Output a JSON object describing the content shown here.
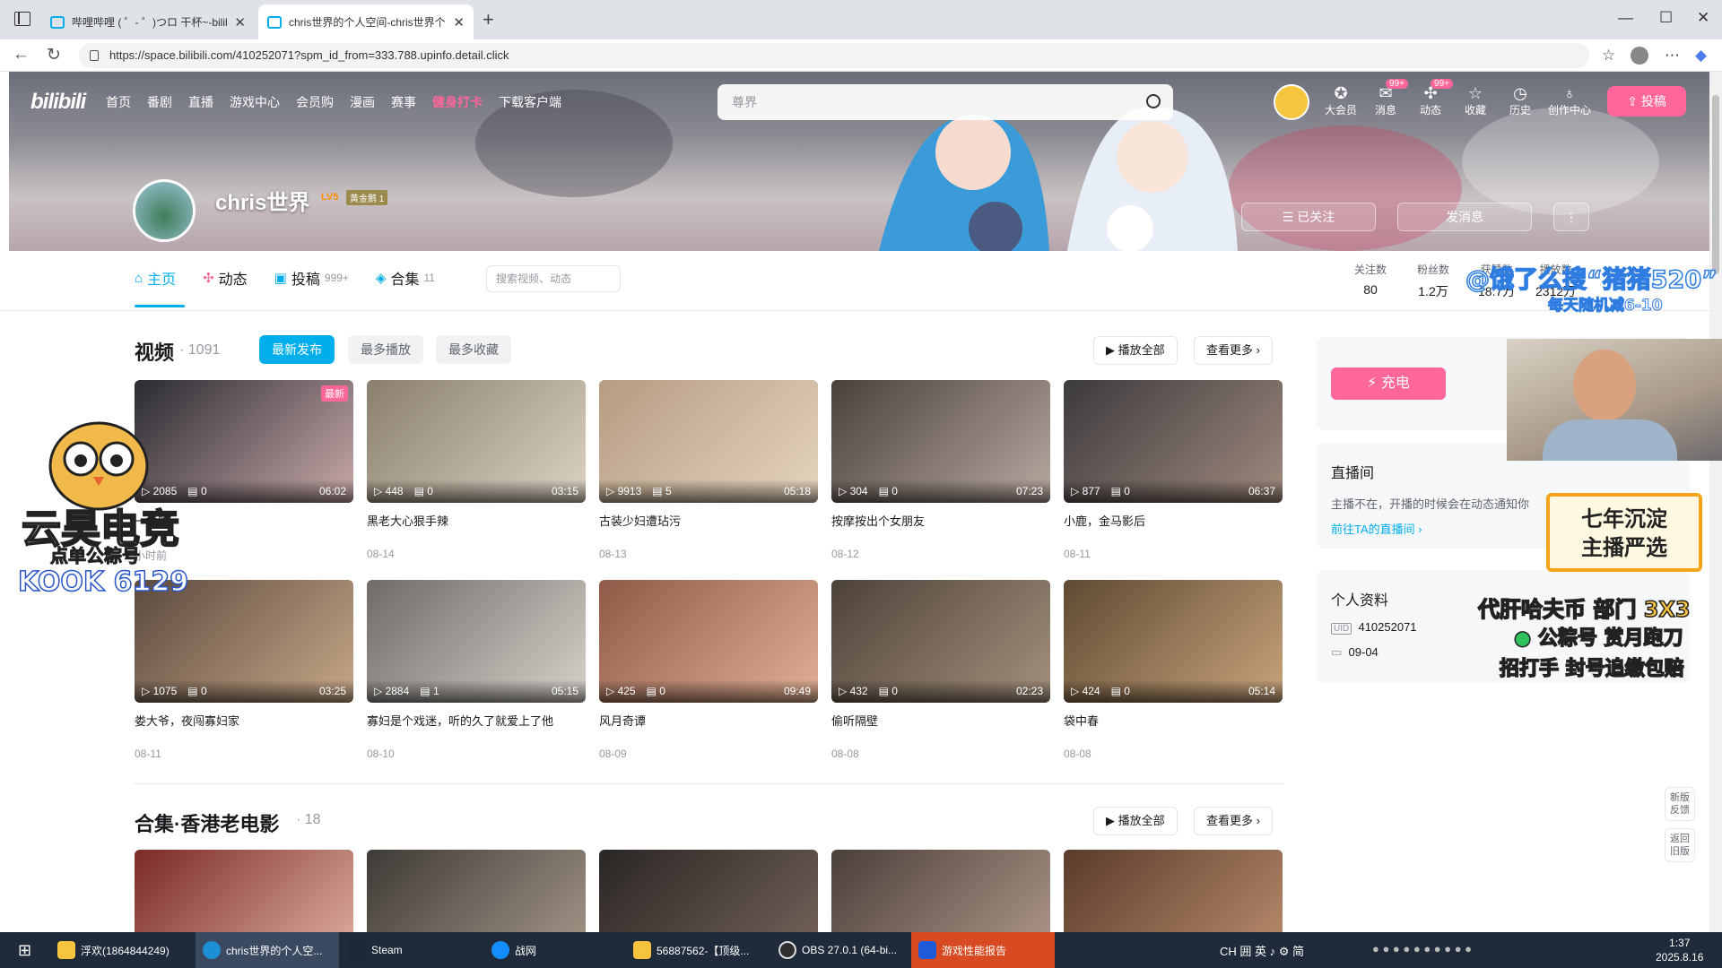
{
  "browser": {
    "tabs": [
      {
        "title": "哔哩哔哩 ( ゜- ゜)つロ 干杯~-bilibili",
        "active": false
      },
      {
        "title": "chris世界的个人空间-chris世界个人主页",
        "active": true
      }
    ],
    "url": "https://space.bilibili.com/410252071?spm_id_from=333.788.upinfo.detail.click"
  },
  "header": {
    "logo": "bilibili",
    "menu": [
      "首页",
      "番剧",
      "直播",
      "游戏中心",
      "会员购",
      "漫画",
      "赛事",
      "健身打卡",
      "下载客户端"
    ],
    "search_placeholder": "尊界",
    "buttons": [
      {
        "label": "大会员",
        "badge": ""
      },
      {
        "label": "消息",
        "badge": "99+"
      },
      {
        "label": "动态",
        "badge": "99+"
      },
      {
        "label": "收藏",
        "badge": ""
      },
      {
        "label": "历史",
        "badge": ""
      },
      {
        "label": "创作中心",
        "badge": ""
      }
    ],
    "upload": "投稿"
  },
  "user": {
    "name": "chris世界",
    "level": "LV5",
    "medal": "黄金鹅",
    "medal_lv": "1",
    "follow_btn": "已关注",
    "msg_btn": "发消息"
  },
  "tabs": [
    {
      "label": "主页",
      "count": ""
    },
    {
      "label": "动态",
      "count": ""
    },
    {
      "label": "投稿",
      "count": "999+"
    },
    {
      "label": "合集",
      "count": "11"
    }
  ],
  "mini_search": "搜索视频、动态",
  "stats": [
    {
      "label": "关注数",
      "value": "80"
    },
    {
      "label": "粉丝数",
      "value": "1.2万"
    },
    {
      "label": "获赞数",
      "value": "18.7万"
    },
    {
      "label": "播放数",
      "value": "2312万"
    }
  ],
  "videos": {
    "title": "视频",
    "count": "1091",
    "sort": [
      "最新发布",
      "最多播放",
      "最多收藏"
    ],
    "play_all": "播放全部",
    "more": "查看更多",
    "items": [
      {
        "plays": "2085",
        "dm": "0",
        "dur": "06:02",
        "title": "一集吧",
        "date": "小时前",
        "new": "最新",
        "c1": "#2a2b32",
        "c2": "#c9a9a9"
      },
      {
        "plays": "448",
        "dm": "0",
        "dur": "03:15",
        "title": "黑老大心狠手辣",
        "date": "08-14",
        "new": "",
        "c1": "#8a7f6e",
        "c2": "#dcd3c4"
      },
      {
        "plays": "9913",
        "dm": "5",
        "dur": "05:18",
        "title": "古装少妇遭玷污",
        "date": "08-13",
        "new": "",
        "c1": "#b59c82",
        "c2": "#e6d4bf"
      },
      {
        "plays": "304",
        "dm": "0",
        "dur": "07:23",
        "title": "按摩按出个女朋友",
        "date": "08-12",
        "new": "",
        "c1": "#4a403c",
        "c2": "#b8a9a0"
      },
      {
        "plays": "877",
        "dm": "0",
        "dur": "06:37",
        "title": "小鹿，金马影后",
        "date": "08-11",
        "new": "",
        "c1": "#3c3a3d",
        "c2": "#a08a7e"
      },
      {
        "plays": "1075",
        "dm": "0",
        "dur": "03:25",
        "title": "娄大爷，夜闯寡妇家",
        "date": "08-11",
        "new": "",
        "c1": "#5c4a3e",
        "c2": "#c7a888"
      },
      {
        "plays": "2884",
        "dm": "1",
        "dur": "05:15",
        "title": "寡妇是个戏迷，听的久了就爱上了他",
        "date": "08-10",
        "new": "",
        "c1": "#6e6a66",
        "c2": "#d8d2cc"
      },
      {
        "plays": "425",
        "dm": "0",
        "dur": "09:49",
        "title": "风月奇谭",
        "date": "08-09",
        "new": "",
        "c1": "#8e5a47",
        "c2": "#e1b095"
      },
      {
        "plays": "432",
        "dm": "0",
        "dur": "02:23",
        "title": "偷听隔壁",
        "date": "08-08",
        "new": "",
        "c1": "#4d4239",
        "c2": "#a5917c"
      },
      {
        "plays": "424",
        "dm": "0",
        "dur": "05:14",
        "title": "袋中春",
        "date": "08-08",
        "new": "",
        "c1": "#5e4a32",
        "c2": "#c9a47c"
      }
    ]
  },
  "collection": {
    "title": "合集·香港老电影",
    "count": "18",
    "play_all": "播放全部",
    "more": "查看更多",
    "thumbs": [
      {
        "c1": "#7a2a25",
        "c2": "#d7a496"
      },
      {
        "c1": "#3e3a36",
        "c2": "#9d8f82"
      },
      {
        "c1": "#2a2624",
        "c2": "#6e5e55"
      },
      {
        "c1": "#4a3f39",
        "c2": "#a89184"
      },
      {
        "c1": "#5a3b2b",
        "c2": "#b18567"
      }
    ]
  },
  "sidebar": {
    "charge": "充电",
    "live_title": "直播间",
    "live_text": "主播不在，开播的时候会在动态通知你",
    "live_link": "前往TA的直播间",
    "profile_title": "个人资料",
    "uid": "410252071",
    "birthday": "09-04"
  },
  "overlays": {
    "search_ad": "@饿了么搜“猪猪520”",
    "search_ad_sub": "每天随机减6-10",
    "owl_name": "云昊电竞",
    "owl_sub": "点单公粽号",
    "kook": "KOOK 6129",
    "badge1": "七年沉淀",
    "badge2": "主播严选",
    "line1": "代肝哈夫币 部门 3X3",
    "line2": "公粽号 赏月跑刀",
    "line3": "招打手 封号追缴包赔"
  },
  "float": {
    "feedback": "新版反馈",
    "back": "返回旧版"
  },
  "taskbar": {
    "items": [
      {
        "label": "浮欢(1864844249)"
      },
      {
        "label": "chris世界的个人空..."
      },
      {
        "label": "Steam"
      },
      {
        "label": "战网"
      },
      {
        "label": "56887562-【顶级..."
      },
      {
        "label": "OBS 27.0.1 (64-bi..."
      },
      {
        "label": "游戏性能报告"
      }
    ],
    "time": "1:37",
    "date": "2025.8.16",
    "tray": "CH 囲 英 ♪ ⚙ 简"
  },
  "colors": {
    "accent": "#00aeec",
    "pink": "#ff6699"
  }
}
